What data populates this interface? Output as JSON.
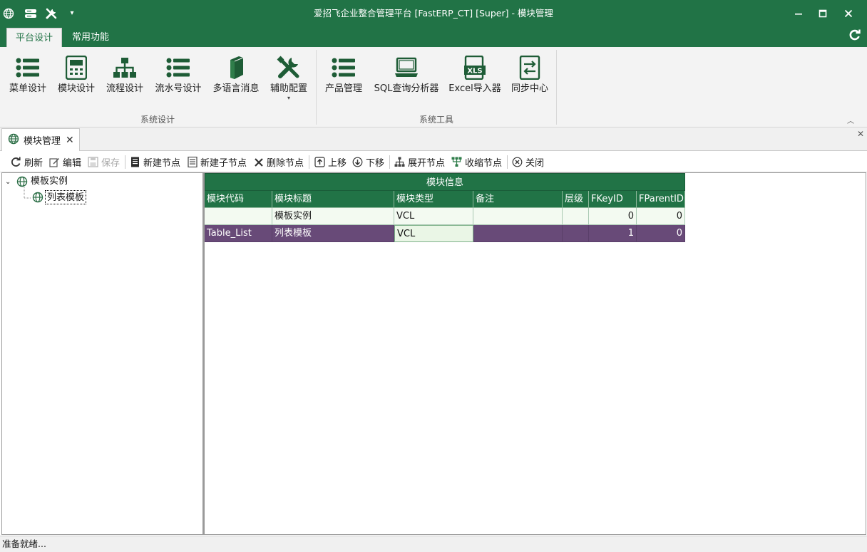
{
  "window": {
    "title": "爱招飞企业整合管理平台 [FastERP_CT] [Super] - 模块管理"
  },
  "ribbon": {
    "tabs": [
      {
        "label": "平台设计",
        "active": true
      },
      {
        "label": "常用功能",
        "active": false
      }
    ],
    "groups": [
      {
        "label": "系统设计",
        "buttons": [
          {
            "label": "菜单设计",
            "icon": "list-icon"
          },
          {
            "label": "模块设计",
            "icon": "calculator-icon"
          },
          {
            "label": "流程设计",
            "icon": "org-chart-icon"
          },
          {
            "label": "流水号设计",
            "icon": "list-icon"
          },
          {
            "label": "多语言消息",
            "icon": "book-icon"
          },
          {
            "label": "辅助配置",
            "icon": "tools-icon",
            "dropdown": "▾"
          }
        ]
      },
      {
        "label": "系统工具",
        "buttons": [
          {
            "label": "产品管理",
            "icon": "list-icon"
          },
          {
            "label": "SQL查询分析器",
            "icon": "laptop-icon"
          },
          {
            "label": "Excel导入器",
            "icon": "xls-icon"
          },
          {
            "label": "同步中心",
            "icon": "sync-icon"
          }
        ]
      }
    ],
    "xls_text": "XLS"
  },
  "doc_tab": {
    "label": "模块管理",
    "close": "✕"
  },
  "toolbar": {
    "refresh": "刷新",
    "edit": "编辑",
    "save": "保存",
    "new_node": "新建节点",
    "new_child": "新建子节点",
    "delete_node": "删除节点",
    "move_up": "上移",
    "move_down": "下移",
    "expand": "展开节点",
    "collapse": "收缩节点",
    "close": "关闭"
  },
  "tree": {
    "root": {
      "label": "模板实例",
      "expanded": true
    },
    "children": [
      {
        "label": "列表模板",
        "selected": true
      }
    ]
  },
  "grid": {
    "band": "模块信息",
    "columns": [
      "模块代码",
      "模块标题",
      "模块类型",
      "备注",
      "层级",
      "FKeyID",
      "FParentID"
    ],
    "rows": [
      [
        "",
        "模板实例",
        "VCL",
        "",
        "",
        "0",
        "0"
      ],
      [
        "Table_List",
        "列表模板",
        "VCL",
        "",
        "",
        "1",
        "0"
      ]
    ],
    "selected_row": 1
  },
  "status": {
    "text": "准备就绪..."
  },
  "colors": {
    "accent": "#217346",
    "selection": "#684a78"
  }
}
